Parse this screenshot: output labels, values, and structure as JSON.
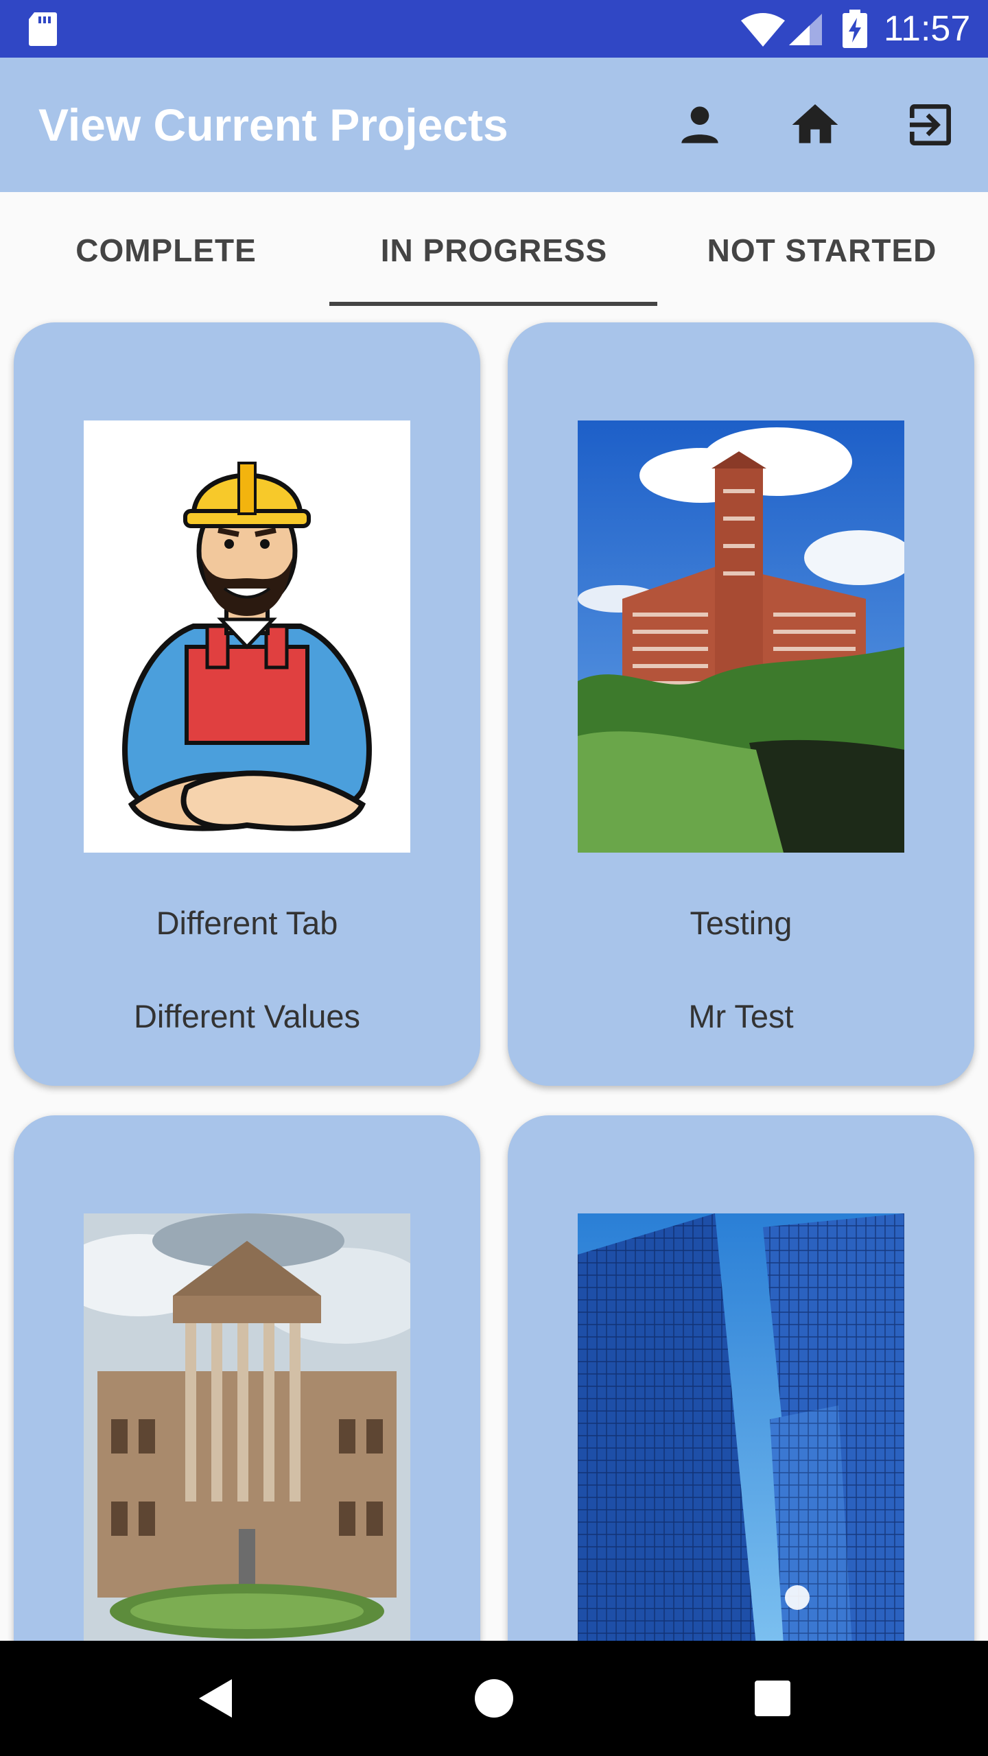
{
  "status_bar": {
    "time": "11:57",
    "icons": [
      "sd-card-icon",
      "wifi-icon",
      "signal-icon",
      "battery-charging-icon"
    ]
  },
  "app_bar": {
    "title": "View Current Projects",
    "actions": [
      "person-icon",
      "home-icon",
      "logout-icon"
    ]
  },
  "tabs": [
    {
      "label": "COMPLETE"
    },
    {
      "label": "IN PROGRESS"
    },
    {
      "label": "NOT STARTED"
    }
  ],
  "selected_tab": "IN PROGRESS",
  "projects": [
    {
      "image": "construction-worker-cartoon",
      "title": "Different Tab",
      "owner": "Different Values"
    },
    {
      "image": "brick-mill-building-photo",
      "title": "Testing",
      "owner": "Mr Test"
    },
    {
      "image": "classical-columned-building-photo",
      "title": "",
      "owner": ""
    },
    {
      "image": "glass-skyscrapers-photo",
      "title": "",
      "owner": ""
    }
  ],
  "colors": {
    "status_bar": "#3047c5",
    "app_bar": "#a8c4ea",
    "card": "#a8c4ea",
    "nav_bar": "#000000"
  },
  "nav": [
    "back-icon",
    "home-circle-icon",
    "recents-icon"
  ]
}
